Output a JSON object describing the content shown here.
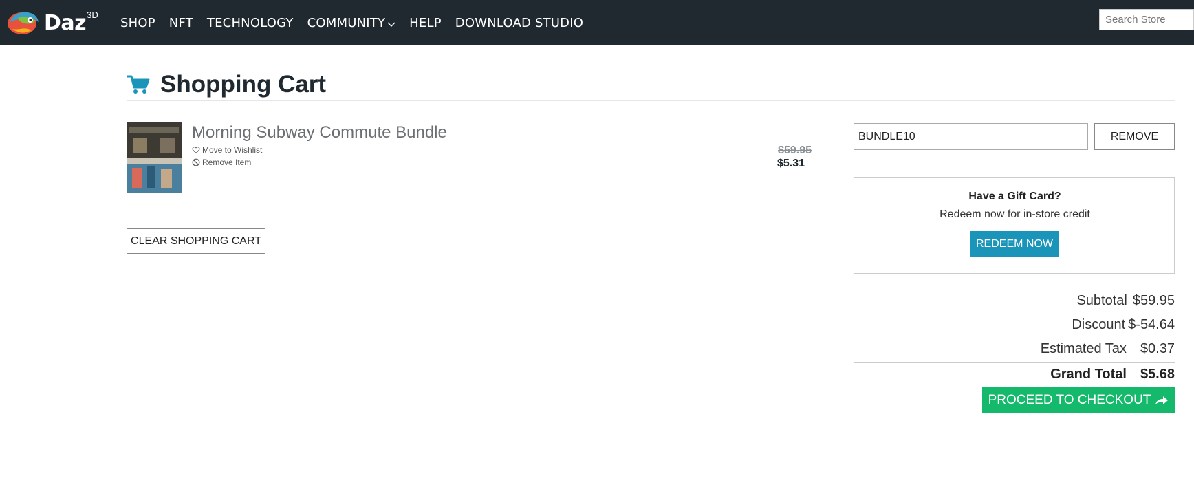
{
  "header": {
    "logo_text": "Daz",
    "logo_sup": "3D",
    "nav": [
      "SHOP",
      "NFT",
      "TECHNOLOGY",
      "COMMUNITY",
      "HELP",
      "DOWNLOAD STUDIO"
    ],
    "search_placeholder": "Search Store"
  },
  "page": {
    "title": "Shopping Cart"
  },
  "cart": {
    "item": {
      "name": "Morning Subway Commute Bundle",
      "wishlist_label": "Move to Wishlist",
      "remove_label": "Remove Item",
      "old_price": "$59.95",
      "new_price": "$5.31"
    },
    "clear_label": "CLEAR SHOPPING CART"
  },
  "coupon": {
    "value": "BUNDLE10",
    "remove_label": "REMOVE"
  },
  "gift": {
    "title": "Have a Gift Card?",
    "subtitle": "Redeem now for in-store credit",
    "button": "REDEEM NOW"
  },
  "totals": {
    "subtotal_label": "Subtotal",
    "subtotal_value": "$59.95",
    "discount_label": "Discount",
    "discount_value": "$-54.64",
    "tax_label": "Estimated Tax",
    "tax_value": "$0.37",
    "grand_label": "Grand Total",
    "grand_value": "$5.68"
  },
  "checkout_label": "PROCEED TO CHECKOUT",
  "colors": {
    "topbar": "#212930",
    "accent_blue": "#1a94b8",
    "checkout_green": "#14b96b"
  }
}
